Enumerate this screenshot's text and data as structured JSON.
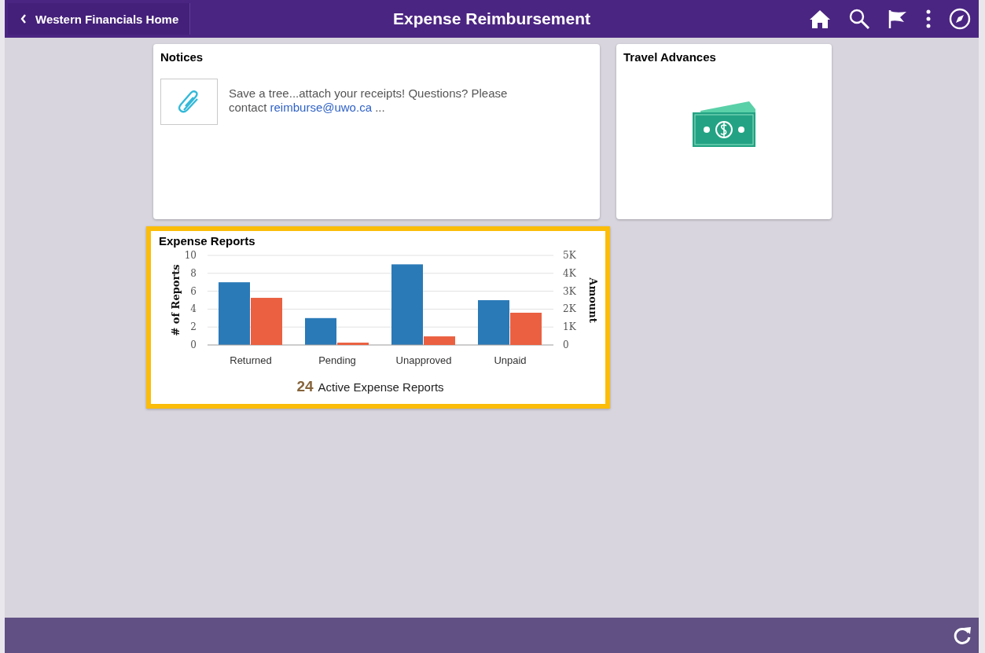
{
  "header": {
    "back_label": "Western Financials Home",
    "title": "Expense Reimbursement"
  },
  "tiles": [
    {
      "kind": "notice",
      "title": "Notices",
      "text": "Save a tree...attach your receipts! Questions? Please contact",
      "link": "reimburse@uwo.ca",
      "more": "..."
    },
    {
      "kind": "icon",
      "title": "Travel Advances"
    },
    {
      "kind": "chart",
      "title": "Expense Reports",
      "selected": true,
      "count": "24",
      "count_label": "Active Expense Reports",
      "chart_layers": [
        {
          "kind": "left",
          "chart_data": {
            "type": "bar",
            "grid": true,
            "categories": [
              "Returned",
              "Pending",
              "Unapproved",
              "Unpaid"
            ],
            "ylabel": "# of Reports",
            "ylim": [
              0,
              10
            ],
            "yticks": [
              0,
              2,
              4,
              6,
              8,
              10
            ],
            "series": [
              {
                "color": "#2a7ab8",
                "values": [
                  7,
                  3,
                  9,
                  5
                ]
              }
            ]
          }
        },
        {
          "kind": "right",
          "chart_data": {
            "type": "bar",
            "ylabel": "Amount",
            "ylim": [
              0,
              5000
            ],
            "yticks": [
              {
                "value": 0,
                "label": "0"
              },
              {
                "value": 1000,
                "label": "1K"
              },
              {
                "value": 2000,
                "label": "2K"
              },
              {
                "value": 3000,
                "label": "3K"
              },
              {
                "value": 4000,
                "label": "4K"
              },
              {
                "value": 5000,
                "label": "5K"
              }
            ],
            "series": [
              {
                "color": "#ea6041",
                "values": [
                  2630,
                  130,
                  480,
                  1800
                ]
              }
            ]
          }
        }
      ]
    }
  ]
}
